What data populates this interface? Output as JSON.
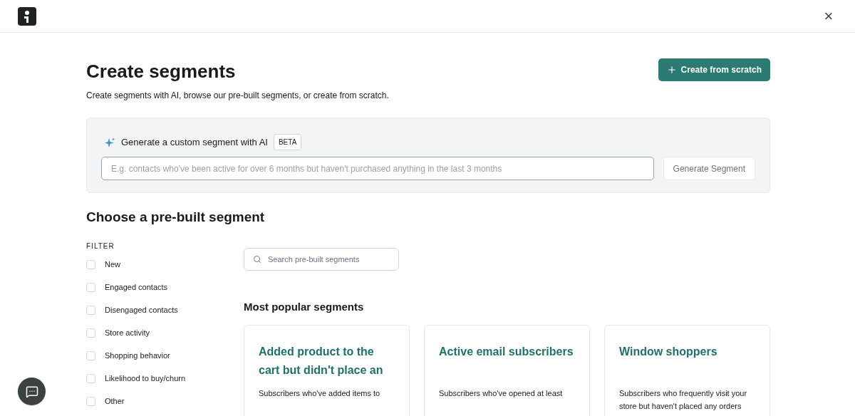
{
  "header": {
    "close": "×"
  },
  "page": {
    "title": "Create segments",
    "subtitle": "Create segments with AI, browse our pre-built segments, or create from scratch.",
    "create_button": "Create from scratch"
  },
  "ai": {
    "label": "Generate a custom segment with AI",
    "badge": "BETA",
    "placeholder": "E.g. contacts who've been active for over 6 months but haven't purchased anything in the last 3 months",
    "button": "Generate Segment",
    "button_disabled": true
  },
  "prebuilt": {
    "title": "Choose a pre-built segment",
    "filter_label": "FILTER",
    "filters": [
      {
        "label": "New",
        "checked": false
      },
      {
        "label": "Engaged contacts",
        "checked": false
      },
      {
        "label": "Disengaged contacts",
        "checked": false
      },
      {
        "label": "Store activity",
        "checked": false
      },
      {
        "label": "Shopping behavior",
        "checked": false
      },
      {
        "label": "Likelihood to buy/churn",
        "checked": false
      },
      {
        "label": "Other",
        "checked": false
      }
    ],
    "search_placeholder": "Search pre-built segments",
    "section_title": "Most popular segments",
    "cards": [
      {
        "title": "Added product to the cart but didn't place an",
        "description": "Subscribers who've added items to"
      },
      {
        "title": "Active email subscribers",
        "description": "Subscribers who've opened at least"
      },
      {
        "title": "Window shoppers",
        "description": "Subscribers who frequently visit your store but haven't placed any orders"
      }
    ]
  }
}
